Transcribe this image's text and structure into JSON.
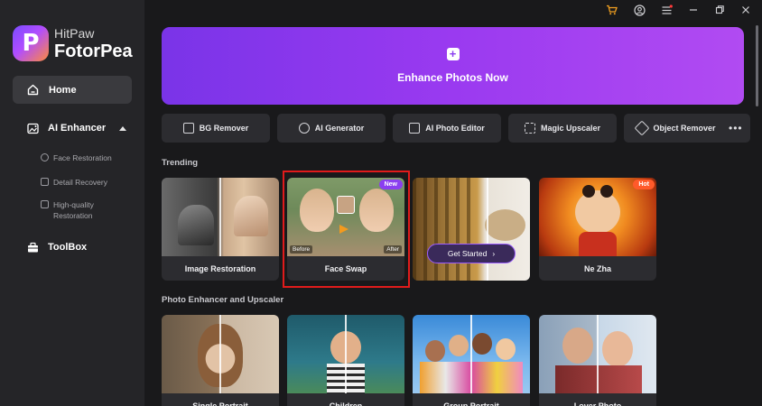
{
  "app": {
    "logo_top": "HitPaw",
    "logo_bottom": "FotorPea",
    "logo_letter": "P"
  },
  "colors": {
    "accent": "#8b3ef0",
    "sidebar_bg": "#252528",
    "main_bg": "#19191b",
    "highlight": "#e01b1b",
    "badge_new": "#8b3ef0",
    "badge_hot": "#ff5a2a"
  },
  "sidebar": {
    "home": {
      "label": "Home",
      "icon": "home-icon"
    },
    "ai_enhancer": {
      "label": "AI Enhancer",
      "icon": "image-enhance-icon",
      "expanded": true,
      "items": [
        {
          "label": "Face Restoration",
          "icon": "face-icon"
        },
        {
          "label": "Detail Recovery",
          "icon": "detail-icon"
        },
        {
          "label": "High-quality Restoration",
          "icon": "quality-icon"
        }
      ]
    },
    "toolbox": {
      "label": "ToolBox",
      "icon": "toolbox-icon"
    }
  },
  "titlebar": {
    "icons": [
      "store-icon",
      "account-icon",
      "menu-icon",
      "minimize-icon",
      "maximize-icon",
      "close-icon"
    ]
  },
  "hero": {
    "label": "Enhance Photos Now",
    "icon": "plus-icon"
  },
  "tools": [
    {
      "label": "BG Remover",
      "icon": "bg-remover-icon"
    },
    {
      "label": "AI Generator",
      "icon": "ai-generator-icon"
    },
    {
      "label": "AI Photo Editor",
      "icon": "photo-editor-icon"
    },
    {
      "label": "Magic Upscaler",
      "icon": "upscaler-icon"
    },
    {
      "label": "Object Remover",
      "icon": "eraser-icon"
    }
  ],
  "trending": {
    "title": "Trending",
    "cards": [
      {
        "caption": "Image Restoration",
        "badge": ""
      },
      {
        "caption": "Face Swap",
        "badge": "New",
        "before": "Before",
        "after": "After"
      },
      {
        "caption": "",
        "badge": "",
        "cta": "Get Started"
      },
      {
        "caption": "Ne Zha",
        "badge": "Hot"
      }
    ]
  },
  "enhancer": {
    "title": "Photo Enhancer and Upscaler",
    "cards": [
      {
        "caption": "Single Portrait"
      },
      {
        "caption": "Children"
      },
      {
        "caption": "Group Portrait"
      },
      {
        "caption": "Lover Photo"
      }
    ]
  }
}
